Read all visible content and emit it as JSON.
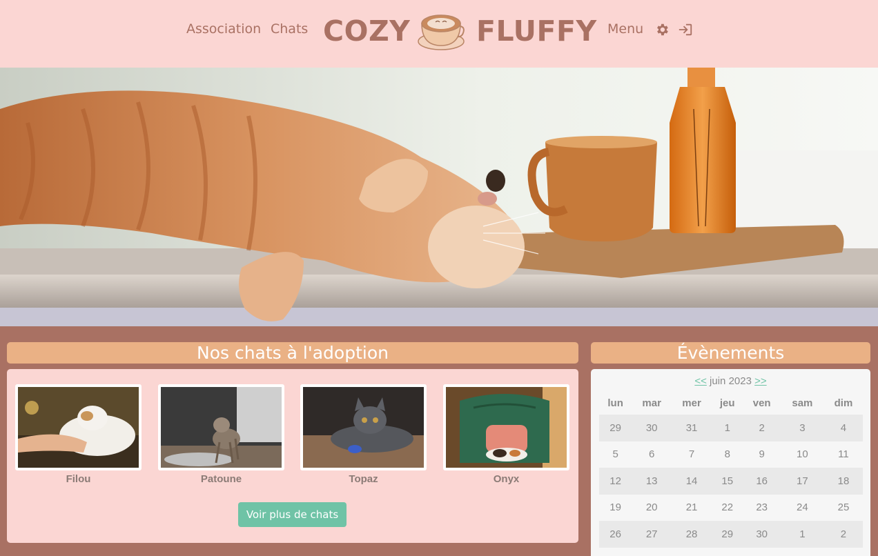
{
  "nav": {
    "association": "Association",
    "chats": "Chats",
    "brand_left": "COZY",
    "brand_right": "FLUFFY",
    "menu": "Menu",
    "settings_icon": "gear-icon",
    "login_icon": "sign-in-icon"
  },
  "colors": {
    "header_bg": "#fbd6d3",
    "page_bg": "#a97163",
    "accent": "#eab185",
    "button": "#6fc3a6",
    "brand_text": "#a97163"
  },
  "adoption": {
    "title": "Nos chats à l'adoption",
    "cats": [
      {
        "name": "Filou"
      },
      {
        "name": "Patoune"
      },
      {
        "name": "Topaz"
      },
      {
        "name": "Onyx"
      }
    ],
    "more_button": "Voir plus de chats"
  },
  "events": {
    "title": "Évènements",
    "prev": "<<",
    "month": "juin 2023",
    "next": ">>",
    "weekdays": [
      "lun",
      "mar",
      "mer",
      "jeu",
      "ven",
      "sam",
      "dim"
    ],
    "weeks": [
      [
        "29",
        "30",
        "31",
        "1",
        "2",
        "3",
        "4"
      ],
      [
        "5",
        "6",
        "7",
        "8",
        "9",
        "10",
        "11"
      ],
      [
        "12",
        "13",
        "14",
        "15",
        "16",
        "17",
        "18"
      ],
      [
        "19",
        "20",
        "21",
        "22",
        "23",
        "24",
        "25"
      ],
      [
        "26",
        "27",
        "28",
        "29",
        "30",
        "1",
        "2"
      ]
    ]
  }
}
